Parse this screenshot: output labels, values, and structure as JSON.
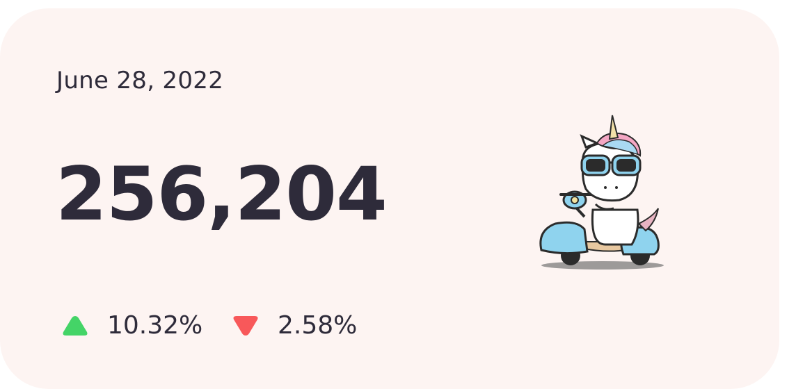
{
  "card": {
    "date": "June 28, 2022",
    "total": "256,204",
    "stats": [
      {
        "value": "10.32%",
        "direction": "up",
        "color": "#44d467",
        "icon": "triangle-up-icon"
      },
      {
        "value": "2.58%",
        "direction": "down",
        "color": "#f8585a",
        "icon": "triangle-down-icon"
      }
    ],
    "background_color": "#fdf4f2"
  }
}
